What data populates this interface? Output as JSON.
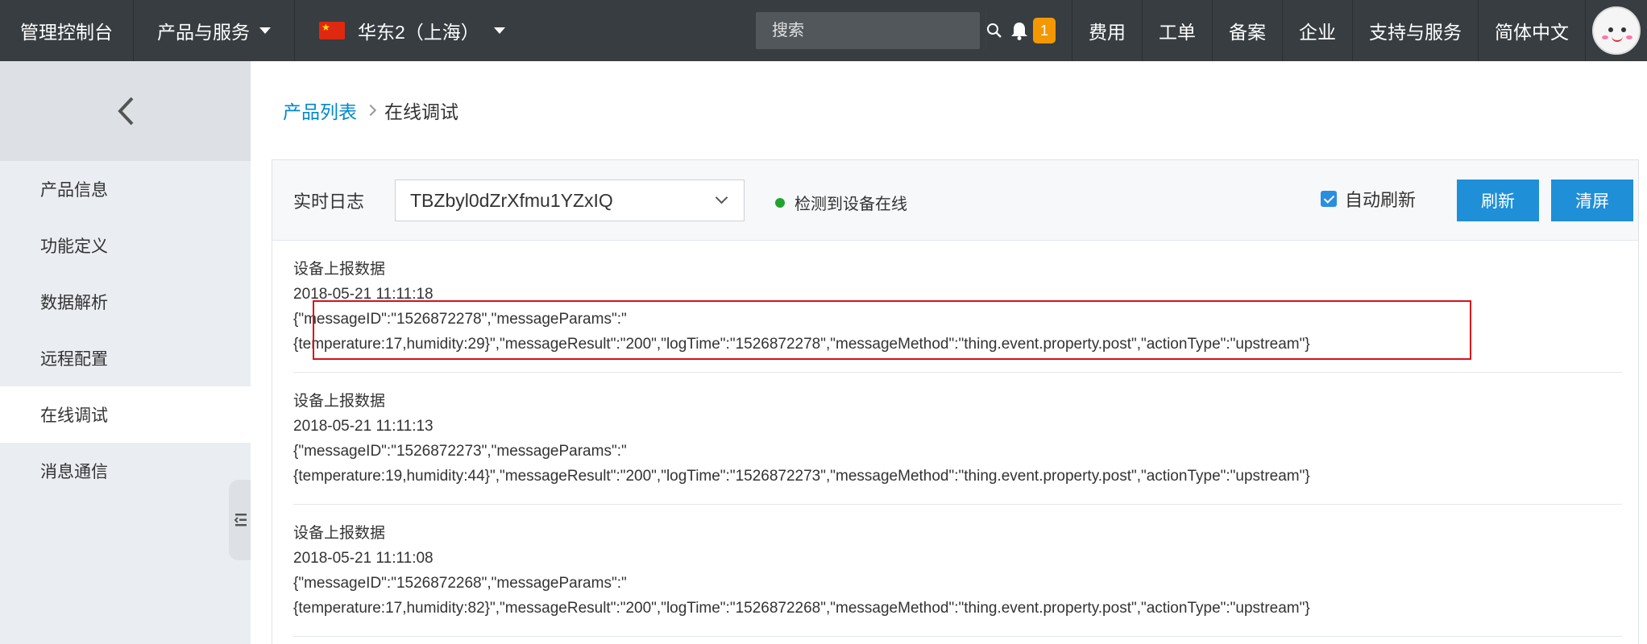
{
  "topbar": {
    "console_label": "管理控制台",
    "products_label": "产品与服务",
    "region_label": "华东2（上海）",
    "search_placeholder": "搜索",
    "notification_count": "1",
    "links": [
      "费用",
      "工单",
      "备案",
      "企业",
      "支持与服务",
      "简体中文"
    ]
  },
  "sidebar": {
    "items": [
      "产品信息",
      "功能定义",
      "数据解析",
      "远程配置",
      "在线调试",
      "消息通信"
    ],
    "active_index": 4
  },
  "breadcrumb": {
    "parent": "产品列表",
    "current": "在线调试"
  },
  "panel": {
    "label": "实时日志",
    "device_selected": "TBZbyl0dZrXfmu1YZxIQ",
    "status_text": "检测到设备在线",
    "auto_refresh_label": "自动刷新",
    "auto_refresh_checked": true,
    "refresh_button": "刷新",
    "clear_button": "清屏"
  },
  "logs": [
    {
      "title": "设备上报数据",
      "time": "2018-05-21 11:11:18",
      "line1": "{\"messageID\":\"1526872278\",\"messageParams\":\"",
      "line2": "{temperature:17,humidity:29}\",\"messageResult\":\"200\",\"logTime\":\"1526872278\",\"messageMethod\":\"thing.event.property.post\",\"actionType\":\"upstream\"}"
    },
    {
      "title": "设备上报数据",
      "time": "2018-05-21 11:11:13",
      "line1": "{\"messageID\":\"1526872273\",\"messageParams\":\"",
      "line2": "{temperature:19,humidity:44}\",\"messageResult\":\"200\",\"logTime\":\"1526872273\",\"messageMethod\":\"thing.event.property.post\",\"actionType\":\"upstream\"}"
    },
    {
      "title": "设备上报数据",
      "time": "2018-05-21 11:11:08",
      "line1": "{\"messageID\":\"1526872268\",\"messageParams\":\"",
      "line2": "{temperature:17,humidity:82}\",\"messageResult\":\"200\",\"logTime\":\"1526872268\",\"messageMethod\":\"thing.event.property.post\",\"actionType\":\"upstream\"}"
    }
  ],
  "colors": {
    "topbar_bg": "#373d41",
    "accent": "#1f8fd8",
    "link": "#0088cc",
    "online": "#1fa42e",
    "badge": "#f39800",
    "highlight_border": "#d9101a"
  }
}
